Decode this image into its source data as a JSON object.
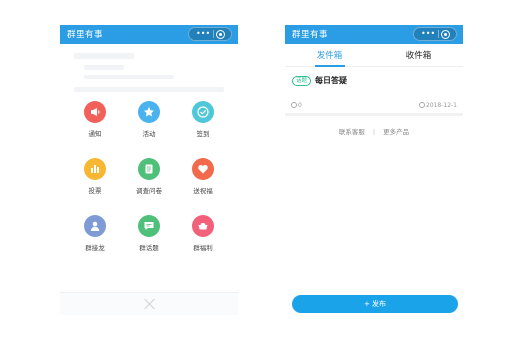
{
  "left_phone": {
    "title": "群里有事",
    "grid": [
      {
        "label": "通知",
        "icon": "megaphone-icon",
        "color": "#f2605a"
      },
      {
        "label": "活动",
        "icon": "star-icon",
        "color": "#4ab2ec"
      },
      {
        "label": "签到",
        "icon": "check-icon",
        "color": "#4fc7d8"
      },
      {
        "label": "投票",
        "icon": "bar-chart-icon",
        "color": "#f7b733"
      },
      {
        "label": "调查问卷",
        "icon": "survey-icon",
        "color": "#4ec07a"
      },
      {
        "label": "送祝福",
        "icon": "heart-icon",
        "color": "#f26a4b"
      },
      {
        "label": "群接龙",
        "icon": "person-icon",
        "color": "#7e9bd6"
      },
      {
        "label": "群话题",
        "icon": "chat-icon",
        "color": "#4ec07a"
      },
      {
        "label": "群福利",
        "icon": "gift-icon",
        "color": "#f2607a"
      }
    ]
  },
  "right_phone": {
    "title": "群里有事",
    "tabs": [
      {
        "label": "发件箱",
        "active": true
      },
      {
        "label": "收件箱",
        "active": false
      }
    ],
    "card": {
      "badge": "话题",
      "title": "每日答疑",
      "count": "0",
      "date": "2018-12-1"
    },
    "footer": {
      "link1": "联系客服",
      "divider": "|",
      "link2": "更多产品"
    },
    "publish_label": "+ 发布"
  }
}
